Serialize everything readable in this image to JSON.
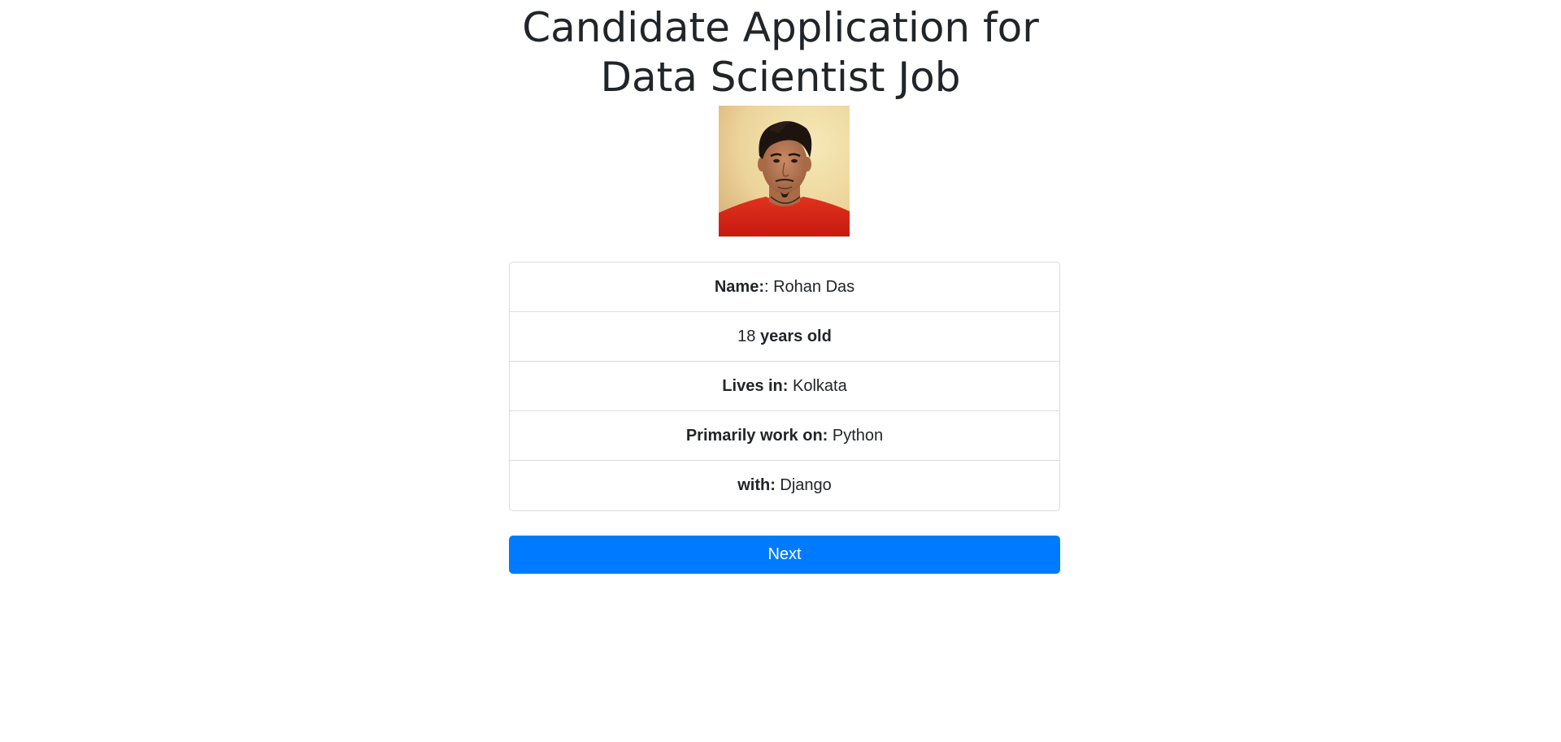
{
  "header": {
    "title_line1": "Candidate Application for",
    "title_line2": "Data Scientist Job"
  },
  "profile": {
    "photo_icon": "candidate-photo"
  },
  "details": {
    "name_label": "Name:",
    "name_value": ": Rohan Das",
    "age_value": "18 ",
    "age_label": "years old",
    "location_label": "Lives in:",
    "location_value": " Kolkata",
    "primary_label": "Primarily work on:",
    "primary_value": " Python",
    "framework_label": "with:",
    "framework_value": " Django"
  },
  "actions": {
    "next_label": "Next"
  },
  "colors": {
    "accent": "#007bff",
    "text": "#212529",
    "border": "#dcdcdc"
  }
}
